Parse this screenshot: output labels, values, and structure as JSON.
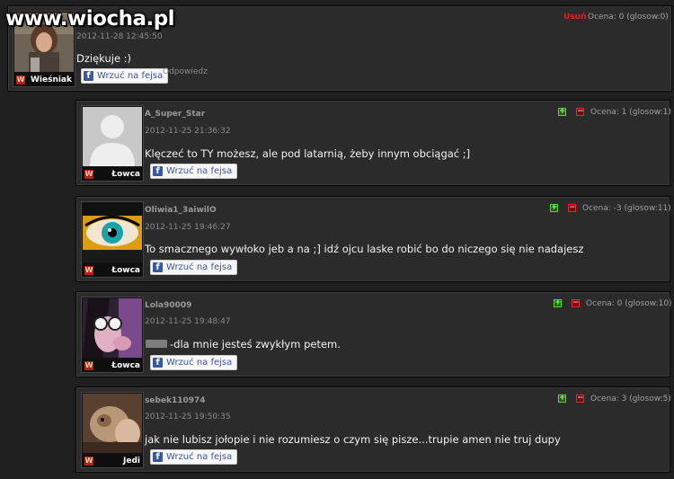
{
  "site": {
    "logo": "www.wiocha.pl"
  },
  "main_comment": {
    "rank": "Wieśniak",
    "date": "2012-11-28 12:45:50",
    "text": "Dziękuje :)",
    "fb_label": "Wrzuć na fejsa",
    "reply_label": "Odpowiedz",
    "delete_label": "Usuń",
    "rating": "Ocena: 0 (glosow:0)"
  },
  "replies": [
    {
      "username": "A_Super_Star",
      "date": "2012-11-25 21:36:32",
      "text": "Klęczeć to TY możesz, ale pod latarnią, żeby innym obciągać ;]",
      "rank": "Łowca",
      "rating": "Ocena: 1 (glosow:1)",
      "fb_label": "Wrzuć na fejsa"
    },
    {
      "username": "Oliwia1_3aiwilO",
      "date": "2012-11-25 19:46:27",
      "text": "To smacznego wywłoko jeb a na ;] idź ojcu laske robić bo do niczego się nie nadajesz",
      "rank": "Łowca",
      "rating": "Ocena: -3 (glosow:11)",
      "fb_label": "Wrzuć na fejsa"
    },
    {
      "username": "Lola90009",
      "date": "2012-11-25 19:48:47",
      "text": "-dla mnie jesteś zwykłym petem.",
      "rank": "Łowca",
      "rating": "Ocena: 0 (glosow:10)",
      "fb_label": "Wrzuć na fejsa"
    },
    {
      "username": "sebek110974",
      "date": "2012-11-25 19:50:35",
      "text": "jak nie lubisz jołopie i nie rozumiesz o czym się pisze...trupie amen nie truj dupy",
      "rank": "Jedi",
      "rating": "Ocena: 3 (glosow:5)",
      "fb_label": "Wrzuć na fejsa"
    }
  ],
  "icons": {
    "plus": "plus-icon",
    "minus": "minus-icon",
    "facebook": "facebook-icon",
    "rank": "rank-badge-icon"
  }
}
